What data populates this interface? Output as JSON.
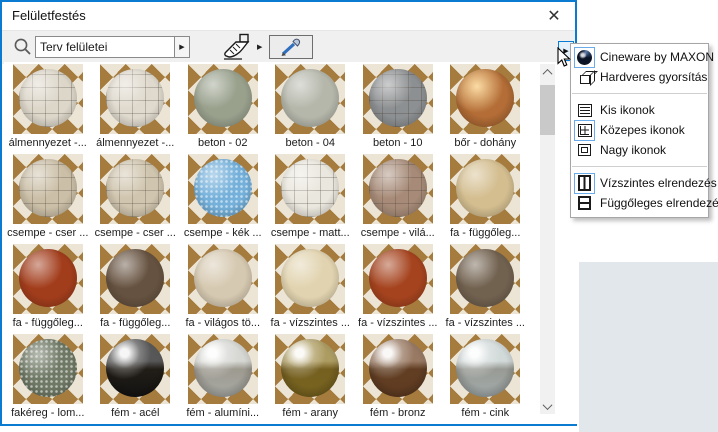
{
  "window": {
    "title": "Felületfestés",
    "close_glyph": "✕"
  },
  "toolbar": {
    "search_value": "Terv felületei",
    "input_dropdown_glyph": "▶",
    "brush_dropdown_glyph": "▶",
    "flyout_glyph": "▶"
  },
  "colors": {
    "accent": "#0b7ad1",
    "checker_dark": "#a57b3e",
    "checker_light": "#ece4d4",
    "menu_selection": "#6aabe8",
    "bg_right_lower": "#e1e7ea"
  },
  "materials": [
    {
      "name": "álmennyezet -...",
      "color": "#ddd7ca",
      "finish": "grid"
    },
    {
      "name": "álmennyezet -...",
      "color": "#e0dace",
      "finish": "grid"
    },
    {
      "name": "beton - 02",
      "color": "#99a18d",
      "finish": "plain"
    },
    {
      "name": "beton - 04",
      "color": "#b5b7ab",
      "finish": "plain"
    },
    {
      "name": "beton - 10",
      "color": "#8d9092",
      "finish": "grid"
    },
    {
      "name": "bőr - dohány",
      "color": "#b46d36",
      "finish": "sheen"
    },
    {
      "name": "csempe - cser ...",
      "color": "#cbbfa7",
      "finish": "grid"
    },
    {
      "name": "csempe - cser ...",
      "color": "#d0c5ae",
      "finish": "grid"
    },
    {
      "name": "csempe - kék ...",
      "color": "#74b0da",
      "finish": "speckle"
    },
    {
      "name": "csempe - matt...",
      "color": "#eae7de",
      "finish": "grid"
    },
    {
      "name": "csempe - vilá...",
      "color": "#a78b78",
      "finish": "grid"
    },
    {
      "name": "fa - függőleg...",
      "color": "#d4be90",
      "finish": "plain"
    },
    {
      "name": "fa - függőleg...",
      "color": "#a23d1c",
      "finish": "plain"
    },
    {
      "name": "fa - függőleg...",
      "color": "#665240",
      "finish": "plain"
    },
    {
      "name": "fa - világos tö...",
      "color": "#d6c9b1",
      "finish": "plain"
    },
    {
      "name": "fa - vízszintes ...",
      "color": "#e1d3af",
      "finish": "plain"
    },
    {
      "name": "fa - vízszintes ...",
      "color": "#a5431e",
      "finish": "plain"
    },
    {
      "name": "fa - vízszintes ...",
      "color": "#71614f",
      "finish": "plain"
    },
    {
      "name": "fakéreg - lom...",
      "color": "#6e7864",
      "finish": "speckle"
    },
    {
      "name": "fém - acél",
      "color": "#161616",
      "finish": "metal"
    },
    {
      "name": "fém - alumíni...",
      "color": "#c7c9c3",
      "finish": "metal"
    },
    {
      "name": "fém - arany",
      "color": "#8e7624",
      "finish": "metal"
    },
    {
      "name": "fém - bronz",
      "color": "#714627",
      "finish": "metal"
    },
    {
      "name": "fém - cink",
      "color": "#c0caca",
      "finish": "metal"
    }
  ],
  "menu": {
    "items": [
      {
        "label": "Cineware by MAXON",
        "icon": "cineware",
        "selected": true
      },
      {
        "label": "Hardveres gyorsítás",
        "icon": "cube",
        "selected": false
      },
      {
        "separator": true
      },
      {
        "label": "Kis ikonok",
        "icon": "list",
        "selected": false
      },
      {
        "label": "Közepes ikonok",
        "icon": "grid",
        "selected": true
      },
      {
        "label": "Nagy ikonok",
        "icon": "square",
        "selected": false
      },
      {
        "separator": true
      },
      {
        "label": "Vízszintes elrendezés",
        "icon": "vsplit",
        "selected": true
      },
      {
        "label": "Függőleges elrendezés",
        "icon": "hsplit",
        "selected": false
      }
    ]
  }
}
